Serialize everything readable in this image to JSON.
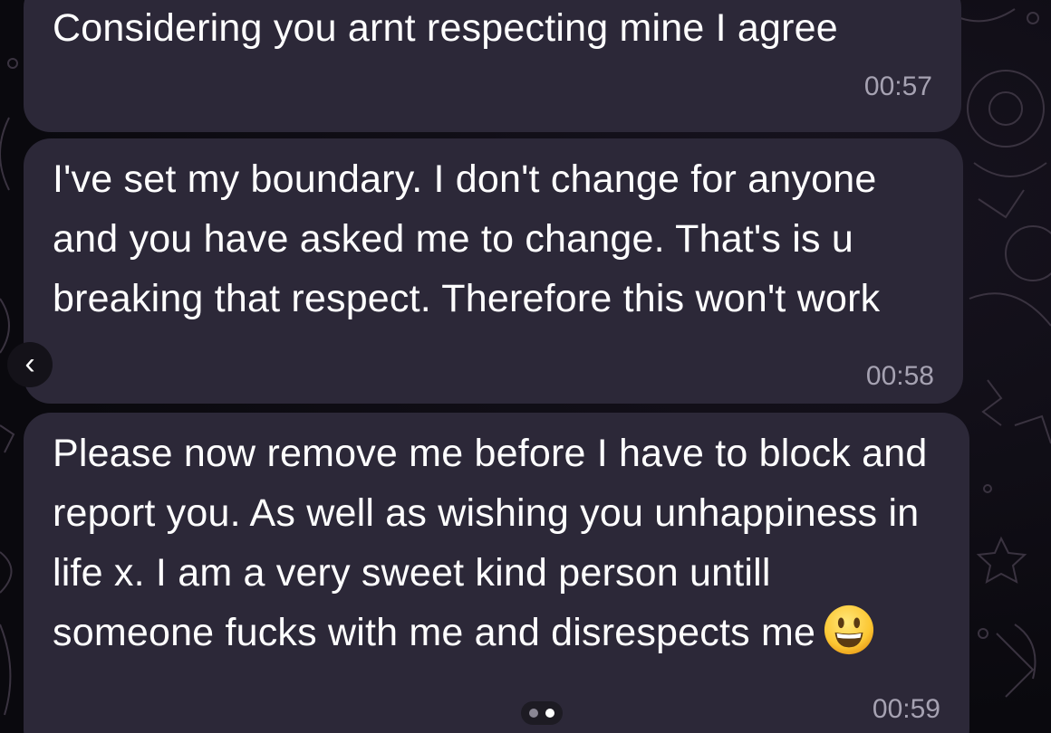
{
  "messages": [
    {
      "text": "Considering you arnt respecting mine I agree",
      "time": "00:57"
    },
    {
      "text": "I've set my boundary. I don't change for anyone and you have asked me to change. That's is u breaking that respect. Therefore this won't work",
      "time": "00:58"
    },
    {
      "text": "Please now remove me before I have to block and report you. As well as wishing you unhappiness in life x. I am a very sweet kind person untill someone fucks with me and disrespects me",
      "emoji": "grinning-face",
      "time": "00:59"
    }
  ],
  "navigation": {
    "back_icon": "chevron-left-icon",
    "back_glyph": "‹"
  },
  "pager": {
    "pages": 2,
    "active_page": 2
  },
  "colors": {
    "background": "#0b0a10",
    "bubble": "#2c2838",
    "text": "#ffffff",
    "timestamp": "#a6a2b2"
  }
}
